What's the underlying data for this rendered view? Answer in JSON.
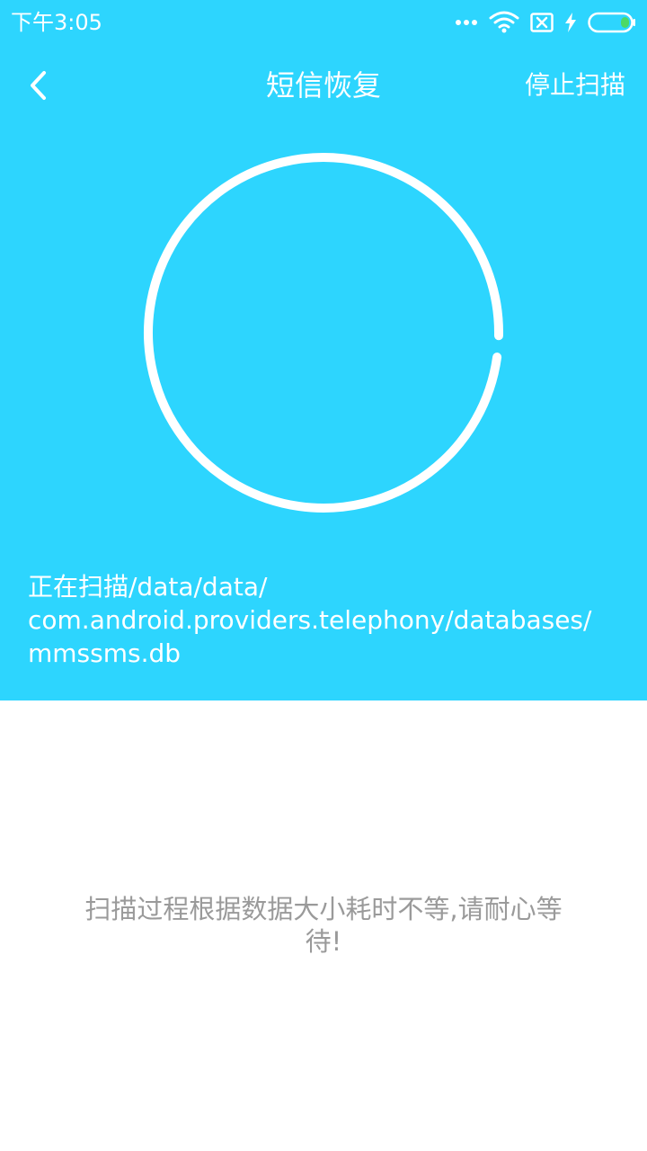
{
  "status_bar": {
    "time": "下午3:05"
  },
  "header": {
    "title": "短信恢复",
    "stop_label": "停止扫描",
    "back_icon": "chevron-left-icon"
  },
  "progress": {
    "fraction": 0.98
  },
  "scan": {
    "line1": "正在扫描/data/data/",
    "line2": "com.android.providers.telephony/databases/",
    "line3": "mmssms.db"
  },
  "hint": {
    "line1": "扫描过程根据数据大小耗时不等,请耐心等",
    "line2": "待!"
  },
  "colors": {
    "primary": "#2dd5fe",
    "text_on_primary": "#ffffff",
    "hint_text": "#9a9a9a",
    "battery_charge": "#4cd964"
  }
}
